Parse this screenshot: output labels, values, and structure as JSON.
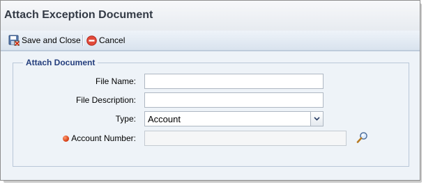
{
  "window": {
    "title": "Attach Exception Document"
  },
  "toolbar": {
    "save_close_label": "Save and Close",
    "cancel_label": "Cancel"
  },
  "form": {
    "section_title": "Attach Document",
    "file_name": {
      "label": "File Name:",
      "value": ""
    },
    "file_description": {
      "label": "File Description:",
      "value": ""
    },
    "type": {
      "label": "Type:",
      "selected": "Account"
    },
    "account_number": {
      "label": "Account Number:",
      "value": "",
      "required": true
    }
  },
  "colors": {
    "section_title": "#233d7c",
    "required_marker": "#d2380f",
    "toolbar_bg": "#dce6f1"
  }
}
